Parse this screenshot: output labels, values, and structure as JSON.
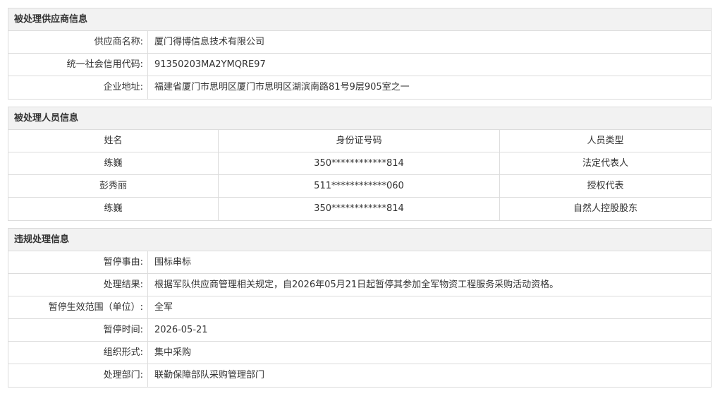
{
  "supplier": {
    "header": "被处理供应商信息",
    "rows": [
      {
        "label": "供应商名称:",
        "value": "厦门得博信息技术有限公司"
      },
      {
        "label": "统一社会信用代码:",
        "value": "91350203MA2YMQRE97"
      },
      {
        "label": "企业地址:",
        "value": "福建省厦门市思明区厦门市思明区湖滨南路81号9层905室之一"
      }
    ]
  },
  "personnel": {
    "header": "被处理人员信息",
    "columns": [
      "姓名",
      "身份证号码",
      "人员类型"
    ],
    "rows": [
      [
        "练巍",
        "350************814",
        "法定代表人"
      ],
      [
        "彭秀丽",
        "511************060",
        "授权代表"
      ],
      [
        "练巍",
        "350************814",
        "自然人控股股东"
      ]
    ]
  },
  "violation": {
    "header": "违规处理信息",
    "rows": [
      {
        "label": "暂停事由:",
        "value": "围标串标"
      },
      {
        "label": "处理结果:",
        "value": "根据军队供应商管理相关规定，自2026年05月21日起暂停其参加全军物资工程服务采购活动资格。"
      },
      {
        "label": "暂停生效范围（单位）:",
        "value": "全军"
      },
      {
        "label": "暂停时间:",
        "value": "2026-05-21"
      },
      {
        "label": "组织形式:",
        "value": "集中采购"
      },
      {
        "label": "处理部门:",
        "value": "联勤保障部队采购管理部门"
      }
    ]
  }
}
